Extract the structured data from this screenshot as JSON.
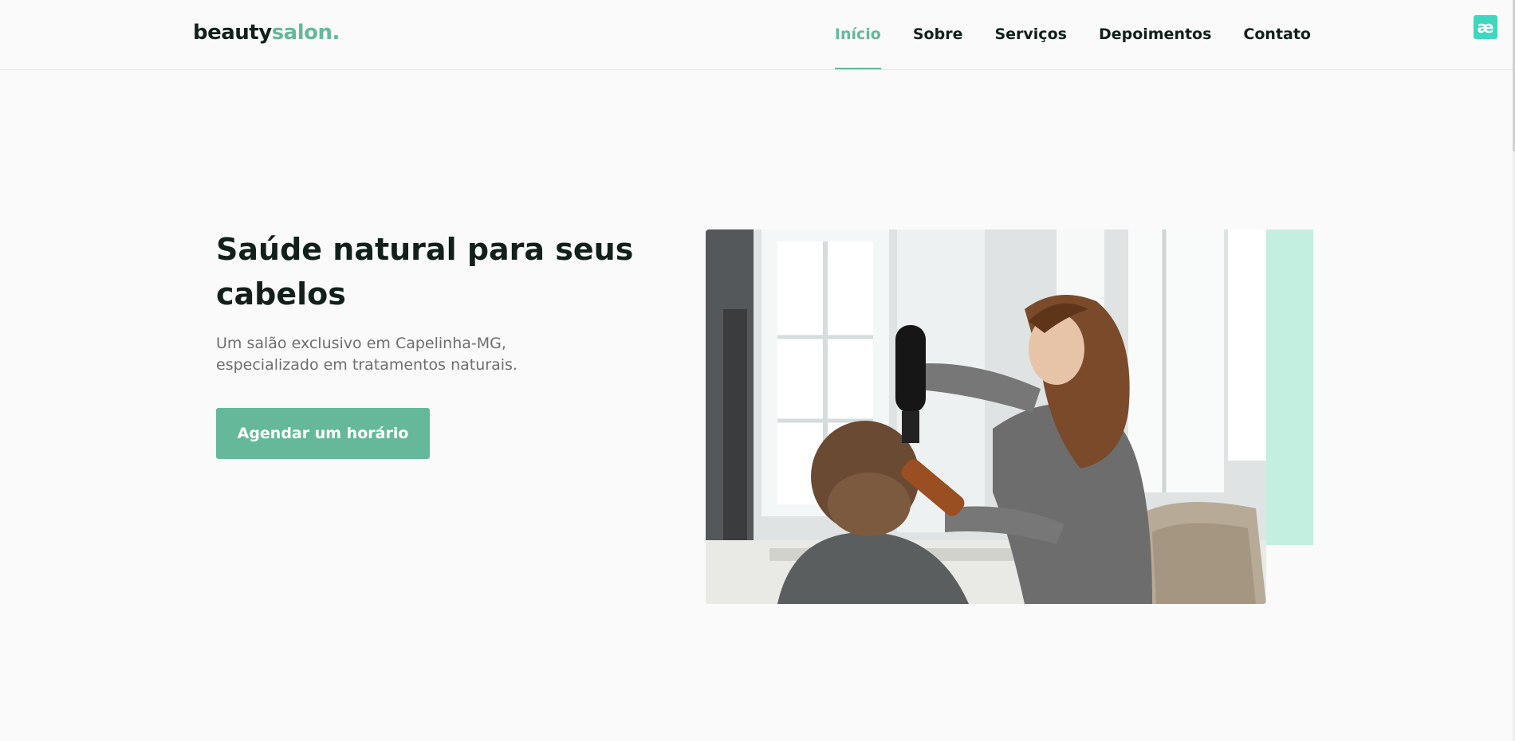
{
  "brand": {
    "part1": "beauty",
    "part2": "salon."
  },
  "nav": {
    "items": [
      {
        "label": "Início",
        "active": true
      },
      {
        "label": "Sobre",
        "active": false
      },
      {
        "label": "Serviços",
        "active": false
      },
      {
        "label": "Depoimentos",
        "active": false
      },
      {
        "label": "Contato",
        "active": false
      }
    ]
  },
  "extension_badge": {
    "glyph": "æ"
  },
  "hero": {
    "title": "Saúde natural para seus cabelos",
    "subtitle": "Um salão exclusivo em Capelinha-MG, especializado em tratamentos naturais.",
    "cta_label": "Agendar um horário",
    "image_icon": "salon-photo"
  },
  "colors": {
    "accent": "#65b99a",
    "accent_light": "#c3efe0",
    "text_dark": "#12201c",
    "text_muted": "#6e6e6e",
    "background": "#fafafa"
  }
}
